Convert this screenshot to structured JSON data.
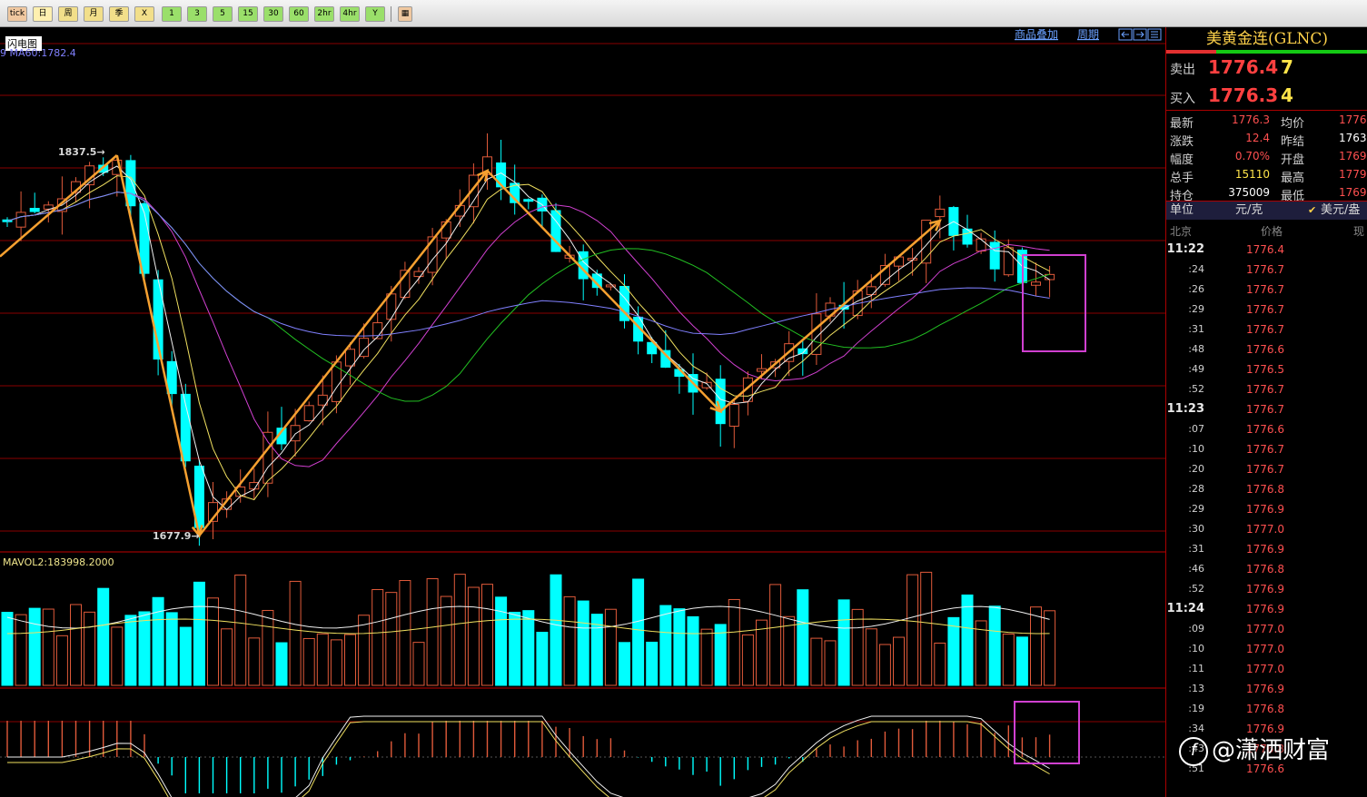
{
  "toolbar": {
    "buttons": [
      "tick",
      "日",
      "周",
      "月",
      "季",
      "X",
      "1",
      "3",
      "5",
      "15",
      "30",
      "60",
      "2hr",
      "4hr",
      "Y",
      "▦"
    ]
  },
  "chart": {
    "flash_label": "闪电图",
    "ma_label": "9 MA60:1782.4",
    "links": {
      "overlay": "商品叠加",
      "period": "周期"
    },
    "price_high_label": "1837.5→",
    "price_low_label": "1677.9→",
    "volume_label": "MAVOL2:183998.2000",
    "colors": {
      "up": "#e05a3a",
      "down": "#00ffff",
      "zigzag": "#f5a030",
      "highlight": "#d040d0",
      "grid": "#8a0000"
    }
  },
  "chart_data": {
    "type": "candlestick",
    "symbol": "美黄金连(GLNC)",
    "annotated_high": 1837.5,
    "annotated_low": 1677.9,
    "ma60": 1782.4,
    "mavol2": 183998.2,
    "zigzag_points": [
      {
        "bar": 8,
        "value": 1837.5
      },
      {
        "bar": 14,
        "value": 1677.9
      },
      {
        "bar": 35,
        "value": 1831
      },
      {
        "bar": 52,
        "value": 1730
      },
      {
        "bar": 68,
        "value": 1810
      }
    ]
  },
  "quote": {
    "title": "美黄金连(GLNC)",
    "sell_label": "卖出",
    "sell_price": "1776.4",
    "sell_qty": "7",
    "buy_label": "买入",
    "buy_price": "1776.3",
    "buy_qty": "4",
    "stats": [
      {
        "label": "最新",
        "value": "1776.3",
        "label2": "均价",
        "value2": "1776"
      },
      {
        "label": "涨跌",
        "value": "12.4",
        "label2": "昨结",
        "value2": "1763"
      },
      {
        "label": "幅度",
        "value": "0.70%",
        "label2": "开盘",
        "value2": "1769"
      },
      {
        "label": "总手",
        "value": "15110",
        "label2": "最高",
        "value2": "1779"
      },
      {
        "label": "持仓",
        "value": "375009",
        "label2": "最低",
        "value2": "1769"
      }
    ],
    "unit_label": "单位",
    "unit_value": "元/克",
    "unit_check": "✔",
    "unit_option": "美元/盎",
    "tick_headers": [
      "北京",
      "价格",
      "现"
    ],
    "ticks": [
      {
        "time": "11:22",
        "price": "1776.4",
        "major": true
      },
      {
        "time": ":24",
        "price": "1776.7"
      },
      {
        "time": ":26",
        "price": "1776.7"
      },
      {
        "time": ":29",
        "price": "1776.7"
      },
      {
        "time": ":31",
        "price": "1776.7"
      },
      {
        "time": ":48",
        "price": "1776.6"
      },
      {
        "time": ":49",
        "price": "1776.5"
      },
      {
        "time": ":52",
        "price": "1776.7"
      },
      {
        "time": "11:23",
        "price": "1776.7",
        "major": true
      },
      {
        "time": ":07",
        "price": "1776.6"
      },
      {
        "time": ":10",
        "price": "1776.7"
      },
      {
        "time": ":20",
        "price": "1776.7"
      },
      {
        "time": ":28",
        "price": "1776.8"
      },
      {
        "time": ":29",
        "price": "1776.9"
      },
      {
        "time": ":30",
        "price": "1777.0"
      },
      {
        "time": ":31",
        "price": "1776.9"
      },
      {
        "time": ":46",
        "price": "1776.8"
      },
      {
        "time": ":52",
        "price": "1776.9"
      },
      {
        "time": "11:24",
        "price": "1776.9",
        "major": true
      },
      {
        "time": ":09",
        "price": "1777.0"
      },
      {
        "time": ":10",
        "price": "1777.0"
      },
      {
        "time": ":11",
        "price": "1777.0"
      },
      {
        "time": ":13",
        "price": "1776.9"
      },
      {
        "time": ":19",
        "price": "1776.8"
      },
      {
        "time": ":34",
        "price": "1776.9"
      },
      {
        "time": ":43",
        "price": "1776.8"
      },
      {
        "time": ":51",
        "price": "1776.6"
      }
    ]
  },
  "watermark": {
    "icon": "f",
    "text": "@潇洒财富"
  }
}
